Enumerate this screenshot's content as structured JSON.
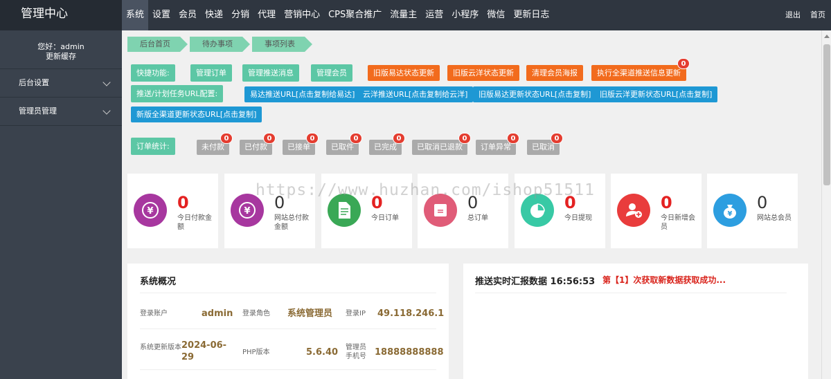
{
  "app": {
    "title": "管理中心"
  },
  "nav": {
    "items": [
      "系统",
      "设置",
      "会员",
      "快递",
      "分销",
      "代理",
      "营销中心",
      "CPS聚合推广",
      "流量主",
      "运营",
      "小程序",
      "微信",
      "更新日志"
    ],
    "logout": "退出",
    "home": "首页"
  },
  "sidebar": {
    "greeting": "您好：admin",
    "refresh_cache": "更新缓存",
    "items": [
      {
        "label": "后台设置"
      },
      {
        "label": "管理员管理"
      }
    ]
  },
  "breadcrumb": [
    "后台首页",
    "待办事项",
    "事项列表"
  ],
  "quick": {
    "label": "快捷功能:",
    "manage_orders": "管理订单",
    "manage_push": "管理推送消息",
    "manage_members": "管理会员",
    "old_yida": "旧版易达状态更新",
    "old_yunyang": "旧版云洋状态更新",
    "clear_poster": "清理会员海报",
    "exec_all": "执行全渠道推送信息更新",
    "exec_all_badge": "0"
  },
  "push": {
    "label": "推送/计划任务URL配置:",
    "yida_push": "易达推送URL[点击复制给易达]",
    "yunyang_push": "云洋推送URL[点击复制给云洋]",
    "old_yida_url": "旧版易达更新状态URL[点击复制]",
    "old_yunyang_url": "旧版云洋更新状态URL[点击复制]",
    "new_all_url": "新版全渠道更新状态URL[点击复制]"
  },
  "orders": {
    "label": "订单统计:",
    "items": [
      {
        "label": "未付款",
        "count": "0"
      },
      {
        "label": "已付款",
        "count": "0"
      },
      {
        "label": "已接单",
        "count": "0"
      },
      {
        "label": "已取件",
        "count": "0"
      },
      {
        "label": "已完成",
        "count": "0"
      },
      {
        "label": "已取消已退款",
        "count": "0"
      },
      {
        "label": "订单异常",
        "count": "0"
      },
      {
        "label": "已取消",
        "count": "0"
      }
    ]
  },
  "watermark": "https://www.huzhan.com/ishop51511",
  "stats": [
    {
      "value": "0",
      "label": "今日付款金额",
      "icon": "yen-icon",
      "color": "#a7379f"
    },
    {
      "value": "0",
      "label": "网站总付款金额",
      "icon": "yen-icon",
      "color": "#a7379f"
    },
    {
      "value": "0",
      "label": "今日订单",
      "icon": "document-icon",
      "color": "#3aa856"
    },
    {
      "value": "0",
      "label": "总订单",
      "icon": "order-icon",
      "color": "#e05c78"
    },
    {
      "value": "0",
      "label": "今日提现",
      "icon": "pie-chart-icon",
      "color": "#38c9a5"
    },
    {
      "value": "0",
      "label": "今日新增会员",
      "icon": "add-user-icon",
      "color": "#e93c3c"
    },
    {
      "value": "0",
      "label": "网站总会员",
      "icon": "money-bag-icon",
      "color": "#2d9ee0"
    }
  ],
  "system": {
    "title": "系统概况",
    "account_label": "登录账户",
    "account": "admin",
    "role_label": "登录角色",
    "role": "系统管理员",
    "ip_label": "登录IP",
    "ip": "49.118.246.1",
    "update_label": "系统更新版本",
    "update": "2024-06-29",
    "php_label": "PHP版本",
    "php": "5.6.40",
    "phone_label": "管理员手机号",
    "phone": "18888888888"
  },
  "realtime": {
    "title": "推送实时汇报数据",
    "time": "16:56:53",
    "message": "第【1】次获取新数据获取成功..."
  },
  "colors": {
    "topbar": "#2f3640",
    "sidebar": "#3a424d",
    "green": "#5cc7a5",
    "orange": "#f26b1d",
    "blue": "#1e98d4",
    "badge": "#e43d30"
  }
}
